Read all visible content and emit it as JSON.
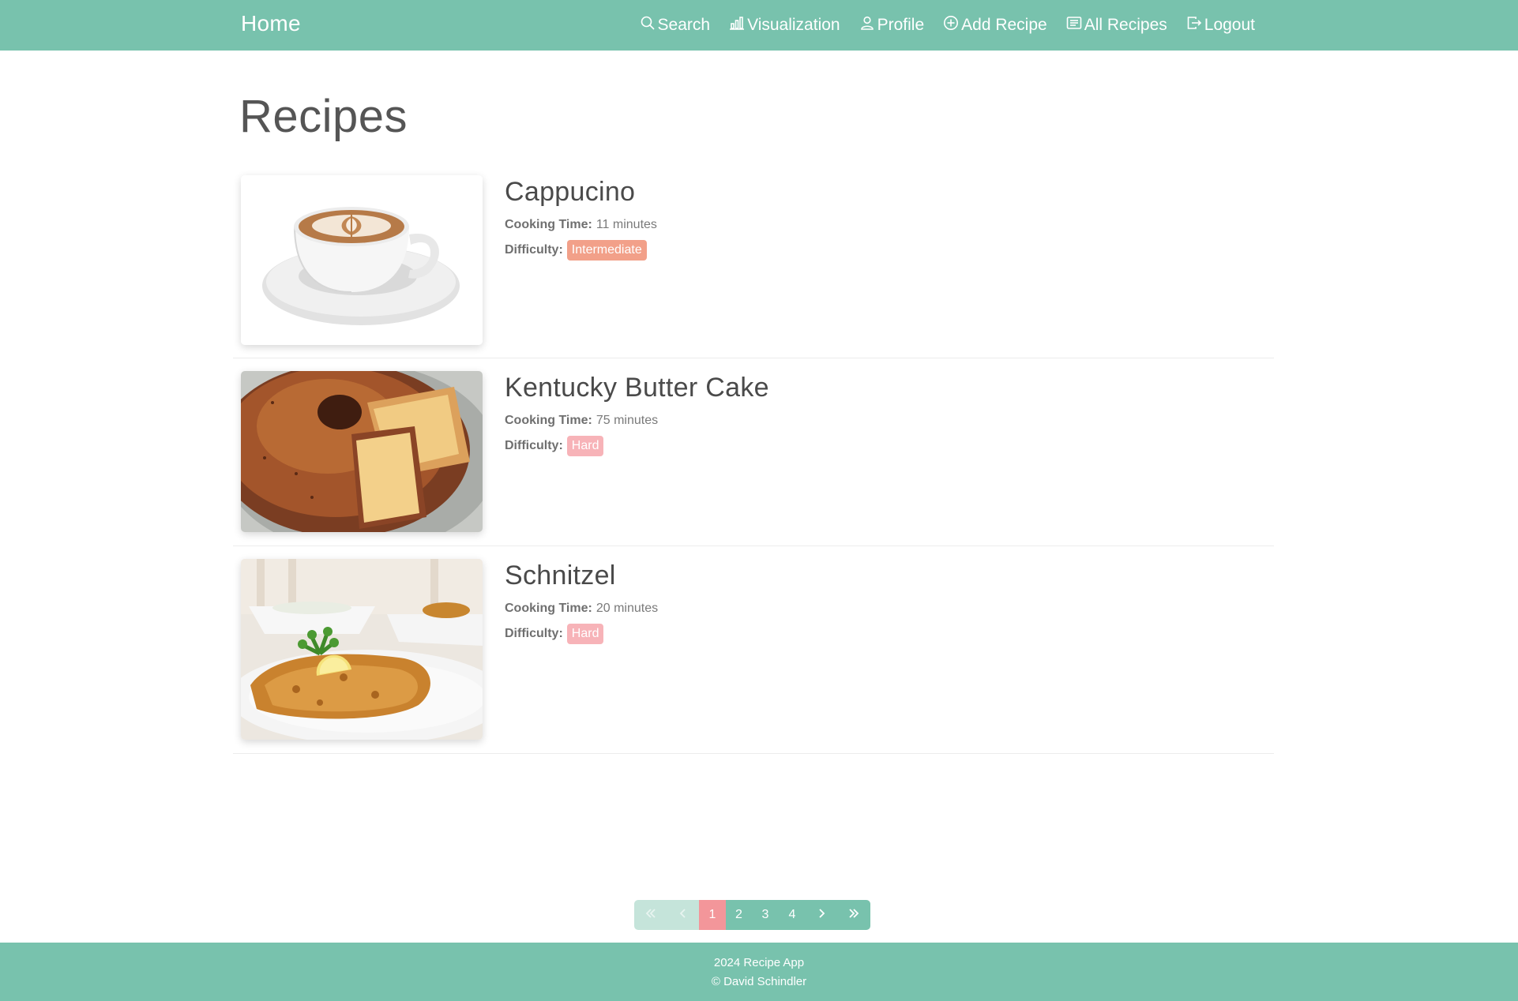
{
  "navbar": {
    "brand": "Home",
    "links": [
      {
        "label": "Search",
        "icon": "search-icon"
      },
      {
        "label": "Visualization",
        "icon": "bar-chart-icon"
      },
      {
        "label": "Profile",
        "icon": "person-icon"
      },
      {
        "label": "Add Recipe",
        "icon": "plus-circle-icon"
      },
      {
        "label": "All Recipes",
        "icon": "card-list-icon"
      },
      {
        "label": "Logout",
        "icon": "logout-icon"
      }
    ]
  },
  "main": {
    "title": "Recipes",
    "cooking_time_label": "Cooking Time:",
    "difficulty_label": "Difficulty:",
    "recipes": [
      {
        "name": "Cappucino",
        "cooking_time": "11 minutes",
        "difficulty": "Intermediate",
        "difficulty_color": "#f2a089",
        "image": "cappuccino-photo"
      },
      {
        "name": "Kentucky Butter Cake",
        "cooking_time": "75 minutes",
        "difficulty": "Hard",
        "difficulty_color": "#f7b3b8",
        "image": "butter-cake-photo"
      },
      {
        "name": "Schnitzel",
        "cooking_time": "20 minutes",
        "difficulty": "Hard",
        "difficulty_color": "#f7b3b8",
        "image": "schnitzel-photo"
      }
    ]
  },
  "pagination": {
    "pages": [
      "1",
      "2",
      "3",
      "4"
    ],
    "current": "1"
  },
  "footer": {
    "line1": "2024 Recipe App",
    "line2": "© David Schindler"
  },
  "colors": {
    "primary": "#78c2ad",
    "secondary": "#f3969a",
    "intermediate": "#f2a089",
    "hard": "#f7b3b8"
  }
}
